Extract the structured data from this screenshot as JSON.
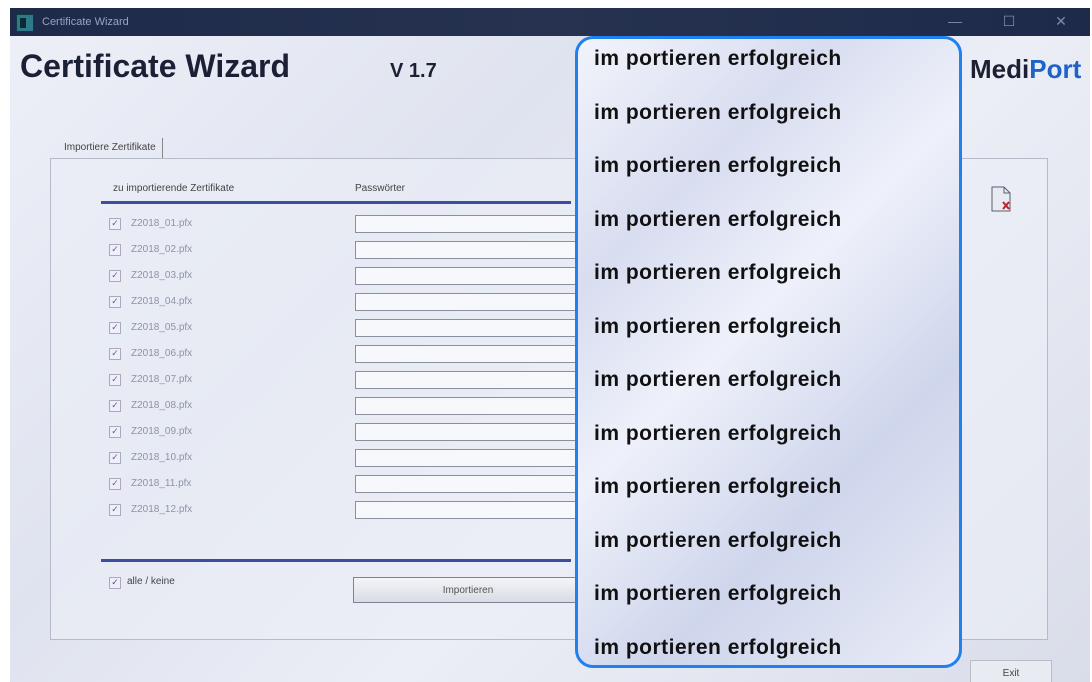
{
  "window": {
    "title": "Certificate Wizard",
    "controls": {
      "minimize": "—",
      "maximize": "☐",
      "close": "✕"
    }
  },
  "header": {
    "title": "Certificate Wizard",
    "version": "V 1.7",
    "brand_a": "Medi",
    "brand_b": "Port"
  },
  "tab": {
    "label": "Importiere Zertifikate"
  },
  "columns": {
    "files": "zu importierende Zertifikate",
    "passwords": "Passwörter"
  },
  "certificates": [
    {
      "file": "Z2018_01.pfx",
      "checked": true
    },
    {
      "file": "Z2018_02.pfx",
      "checked": true
    },
    {
      "file": "Z2018_03.pfx",
      "checked": true
    },
    {
      "file": "Z2018_04.pfx",
      "checked": true
    },
    {
      "file": "Z2018_05.pfx",
      "checked": true
    },
    {
      "file": "Z2018_06.pfx",
      "checked": true
    },
    {
      "file": "Z2018_07.pfx",
      "checked": true
    },
    {
      "file": "Z2018_08.pfx",
      "checked": true
    },
    {
      "file": "Z2018_09.pfx",
      "checked": true
    },
    {
      "file": "Z2018_10.pfx",
      "checked": true
    },
    {
      "file": "Z2018_11.pfx",
      "checked": true
    },
    {
      "file": "Z2018_12.pfx",
      "checked": true
    }
  ],
  "select_all": {
    "label": "alle / keine",
    "checked": true
  },
  "import_button": "Importieren",
  "exit_button": "Exit",
  "popup": {
    "messages": [
      "im portieren erfolgreich",
      "im portieren erfolgreich",
      "im portieren erfolgreich",
      "im portieren erfolgreich",
      "im portieren erfolgreich",
      "im portieren erfolgreich",
      "im portieren erfolgreich",
      "im portieren erfolgreich",
      "im portieren erfolgreich",
      "im portieren erfolgreich",
      "im portieren erfolgreich",
      "im portieren erfolgreich"
    ]
  },
  "colors": {
    "popup_border": "#2080f0",
    "brand_accent": "#1e63c8",
    "rule": "#3d4da0"
  },
  "icons": {
    "app": "certificate-app-icon",
    "document": "document-delete-icon"
  }
}
